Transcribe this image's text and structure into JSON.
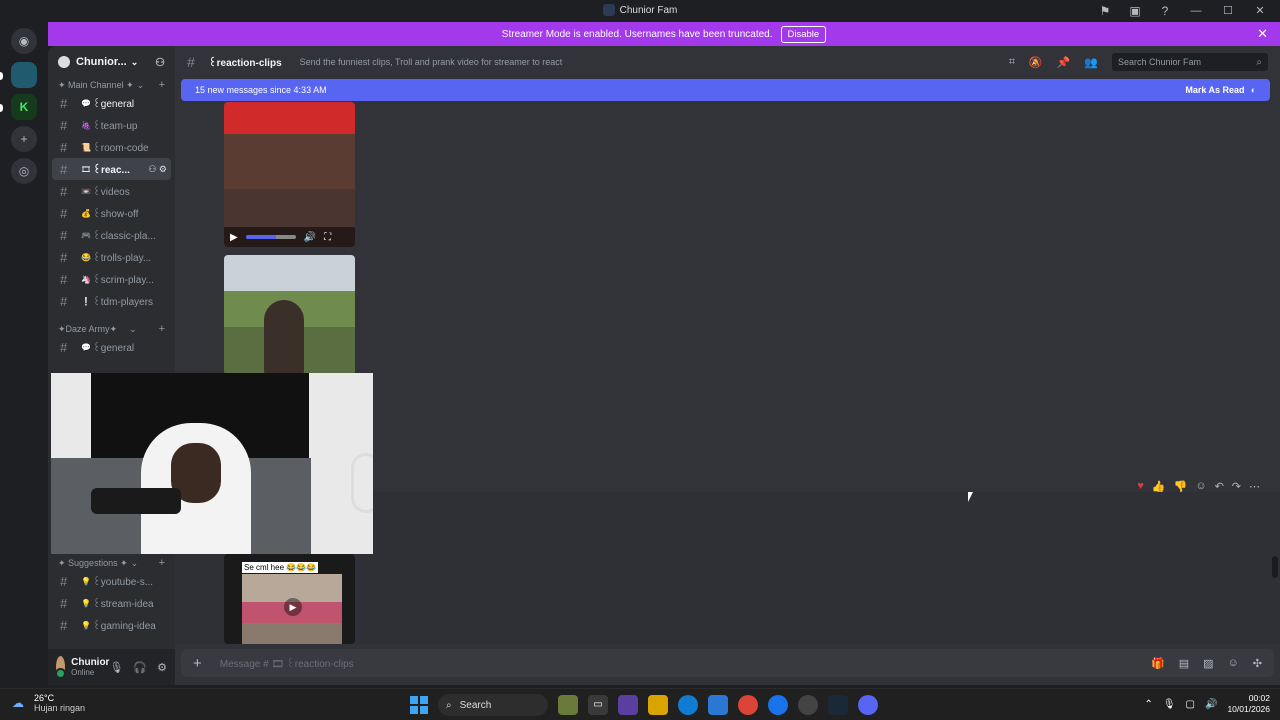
{
  "window": {
    "title": "Chunior Fam",
    "controls": [
      "minimize",
      "maximize",
      "close"
    ]
  },
  "banner": {
    "text": "Streamer Mode is enabled. Usernames have been truncated.",
    "disable_label": "Disable"
  },
  "server": {
    "name": "Chunior...",
    "categories": [
      {
        "name": "✦ Main Channel ✦"
      },
      {
        "name": "✦Daze Army✦"
      },
      {
        "name": "✦ Suggestions ✦"
      }
    ],
    "main_channels": [
      {
        "label": "꒰general",
        "emoji": "💬"
      },
      {
        "label": "꒰team-up",
        "emoji": "🍇"
      },
      {
        "label": "꒰room-code",
        "emoji": "📜"
      },
      {
        "label": "꒰reac...",
        "emoji": "🎞"
      },
      {
        "label": "꒰videos",
        "emoji": "📼"
      },
      {
        "label": "꒰show-off",
        "emoji": "💰"
      },
      {
        "label": "꒰classic-pla...",
        "emoji": "🎮"
      },
      {
        "label": "꒰trolls-play...",
        "emoji": "😂"
      },
      {
        "label": "꒰scrim-play...",
        "emoji": "🦄"
      },
      {
        "label": "꒰tdm-players",
        "emoji": "❕"
      }
    ],
    "daze_channels": [
      {
        "label": "꒰general",
        "emoji": "💬"
      }
    ],
    "suggestion_channels": [
      {
        "label": "꒰youtube-s...",
        "emoji": "💡"
      },
      {
        "label": "꒰stream-idea",
        "emoji": "💡"
      },
      {
        "label": "꒰gaming-idea",
        "emoji": "💡"
      }
    ]
  },
  "user": {
    "name": "Chunior",
    "status": "Online"
  },
  "channel": {
    "name": "꒰reaction-clips",
    "topic": "Send the funniest clips, Troll and prank video for streamer to react"
  },
  "search": {
    "placeholder": "Search Chunior Fam"
  },
  "new_messages": {
    "text": "15 new messages since 4:33 AM",
    "mark_label": "Mark As Read"
  },
  "media3_caption": "Se cml hee 😂😂😂",
  "composer": {
    "placeholder": "Message # 🎞 ꒰reaction-clips"
  },
  "taskbar": {
    "temperature": "26°C",
    "condition": "Hujan ringan",
    "search_label": "Search",
    "time": "00:02",
    "date": "10/01/2026"
  }
}
